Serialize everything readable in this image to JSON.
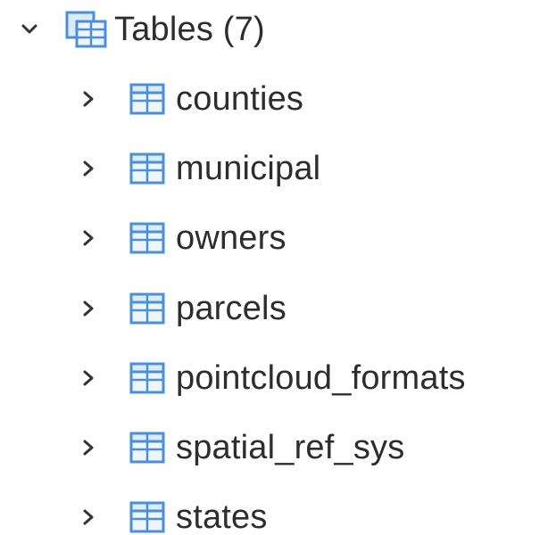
{
  "tree": {
    "group": {
      "label": "Tables (7)",
      "expanded": true,
      "icon": "tables-icon"
    },
    "items": [
      {
        "label": "counties",
        "icon": "table-icon",
        "expanded": false
      },
      {
        "label": "municipal",
        "icon": "table-icon",
        "expanded": false
      },
      {
        "label": "owners",
        "icon": "table-icon",
        "expanded": false
      },
      {
        "label": "parcels",
        "icon": "table-icon",
        "expanded": false
      },
      {
        "label": "pointcloud_formats",
        "icon": "table-icon",
        "expanded": false
      },
      {
        "label": "spatial_ref_sys",
        "icon": "table-icon",
        "expanded": false
      },
      {
        "label": "states",
        "icon": "table-icon",
        "expanded": false
      }
    ]
  },
  "colors": {
    "icon_stroke": "#4a90d9",
    "icon_fill": "#dcebf8",
    "chevron": "#333333",
    "text": "#2d2d2d"
  }
}
